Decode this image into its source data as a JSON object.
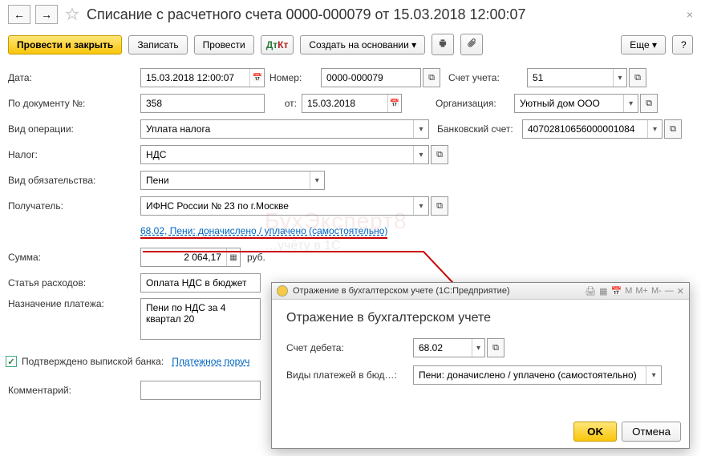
{
  "header": {
    "title": "Списание с расчетного счета 0000-000079 от 15.03.2018 12:00:07"
  },
  "toolbar": {
    "post_close": "Провести и закрыть",
    "save": "Записать",
    "post": "Провести",
    "create_based": "Создать на основании",
    "more": "Еще"
  },
  "form": {
    "date_lbl": "Дата:",
    "date_val": "15.03.2018 12:00:07",
    "num_lbl": "Номер:",
    "num_val": "0000-000079",
    "acct_lbl": "Счет учета:",
    "acct_val": "51",
    "docnum_lbl": "По документу №:",
    "docnum_val": "358",
    "from_lbl": "от:",
    "from_val": "15.03.2018",
    "org_lbl": "Организация:",
    "org_val": "Уютный дом ООО",
    "op_lbl": "Вид операции:",
    "op_val": "Уплата налога",
    "bank_lbl": "Банковский счет:",
    "bank_val": "40702810656000001084",
    "tax_lbl": "Налог:",
    "tax_val": "НДС",
    "oblig_lbl": "Вид обязательства:",
    "oblig_val": "Пени",
    "payee_lbl": "Получатель:",
    "payee_val": "ИФНС России № 23 по г.Москве",
    "link_line": "68.02, Пени: доначислено / уплачено (самостоятельно)",
    "sum_lbl": "Сумма:",
    "sum_val": "2 064,17",
    "sum_unit": "руб.",
    "exp_lbl": "Статья расходов:",
    "exp_val": "Оплата НДС в бюджет",
    "purpose_lbl": "Назначение платежа:",
    "purpose_val": "Пени по НДС за 4 квартал 20",
    "confirmed": "Подтверждено выпиской банка:",
    "payment_order": "Платежное поруч",
    "comment_lbl": "Комментарий:"
  },
  "modal": {
    "window_title": "Отражение в бухгалтерском учете  (1С:Предприятие)",
    "heading": "Отражение в бухгалтерском учете",
    "debit_lbl": "Счет дебета:",
    "debit_val": "68.02",
    "paytype_lbl": "Виды платежей в бюд…:",
    "paytype_val": "Пени: доначислено / уплачено (самостоятельно)",
    "ok": "OK",
    "cancel": "Отмена",
    "tools": {
      "m": "M",
      "mp": "M+",
      "mm": "M-"
    }
  },
  "watermark": {
    "l1": "БухЭксперт8",
    "l2": "…учёту в 1С"
  }
}
